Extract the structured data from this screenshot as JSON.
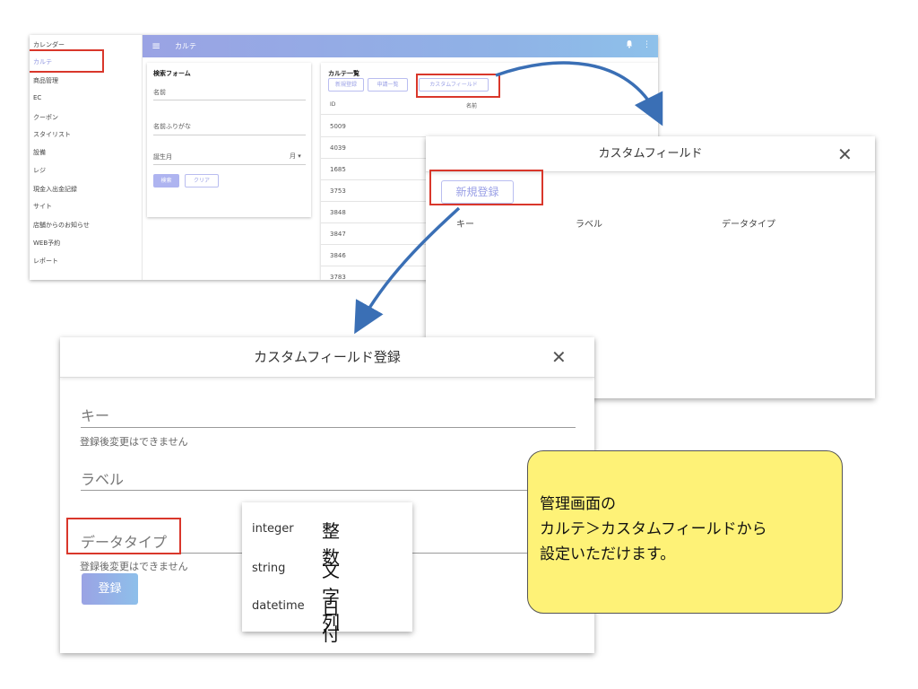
{
  "sidebar": {
    "items": [
      "カレンダー",
      "カルテ",
      "商品管理",
      "EC",
      "クーポン",
      "スタイリスト",
      "設備",
      "レジ",
      "現金入出金記録",
      "サイト",
      "店舗からのお知らせ",
      "WEB予約",
      "レポート"
    ]
  },
  "topbar": {
    "menu_icon": "≡",
    "title": "カルテ",
    "more_icon": "⋮"
  },
  "search_form": {
    "title": "検索フォーム",
    "name_label": "名前",
    "kana_label": "名前ふりがな",
    "birth_label": "誕生月",
    "month_select": "月 ▾",
    "search_button": "検索",
    "clear_button": "クリア"
  },
  "karte_list": {
    "title": "カルテ一覧",
    "buttons": [
      "新規登録",
      "申請一覧",
      "カスタムフィールド"
    ],
    "columns": [
      "ID",
      "名前"
    ],
    "ids": [
      "5009",
      "4039",
      "1685",
      "3753",
      "3848",
      "3847",
      "3846",
      "3783"
    ]
  },
  "custom_field_modal": {
    "title": "カスタムフィールド",
    "close": "✕",
    "new_button": "新規登録",
    "columns": [
      "キー",
      "ラベル",
      "データタイプ"
    ]
  },
  "register_modal": {
    "title": "カスタムフィールド登録",
    "close": "✕",
    "key_label": "キー",
    "key_hint": "登録後変更はできません",
    "label_label": "ラベル",
    "datatype_label": "データタイプ",
    "datatype_hint": "登録後変更はできません",
    "submit_button": "登録"
  },
  "datatype_options": [
    {
      "code": "integer",
      "ja": "整数"
    },
    {
      "code": "string",
      "ja": "文字列"
    },
    {
      "code": "datetime",
      "ja": "日付"
    }
  ],
  "callout": {
    "lines": [
      "管理画面の",
      "カルテ＞カスタムフィールドから",
      "設定いただけます。"
    ]
  },
  "colors": {
    "highlight": "#d9372b",
    "accent": "#9aa3e4",
    "callout_bg": "#fef277",
    "arrow": "#3a6fb5"
  }
}
